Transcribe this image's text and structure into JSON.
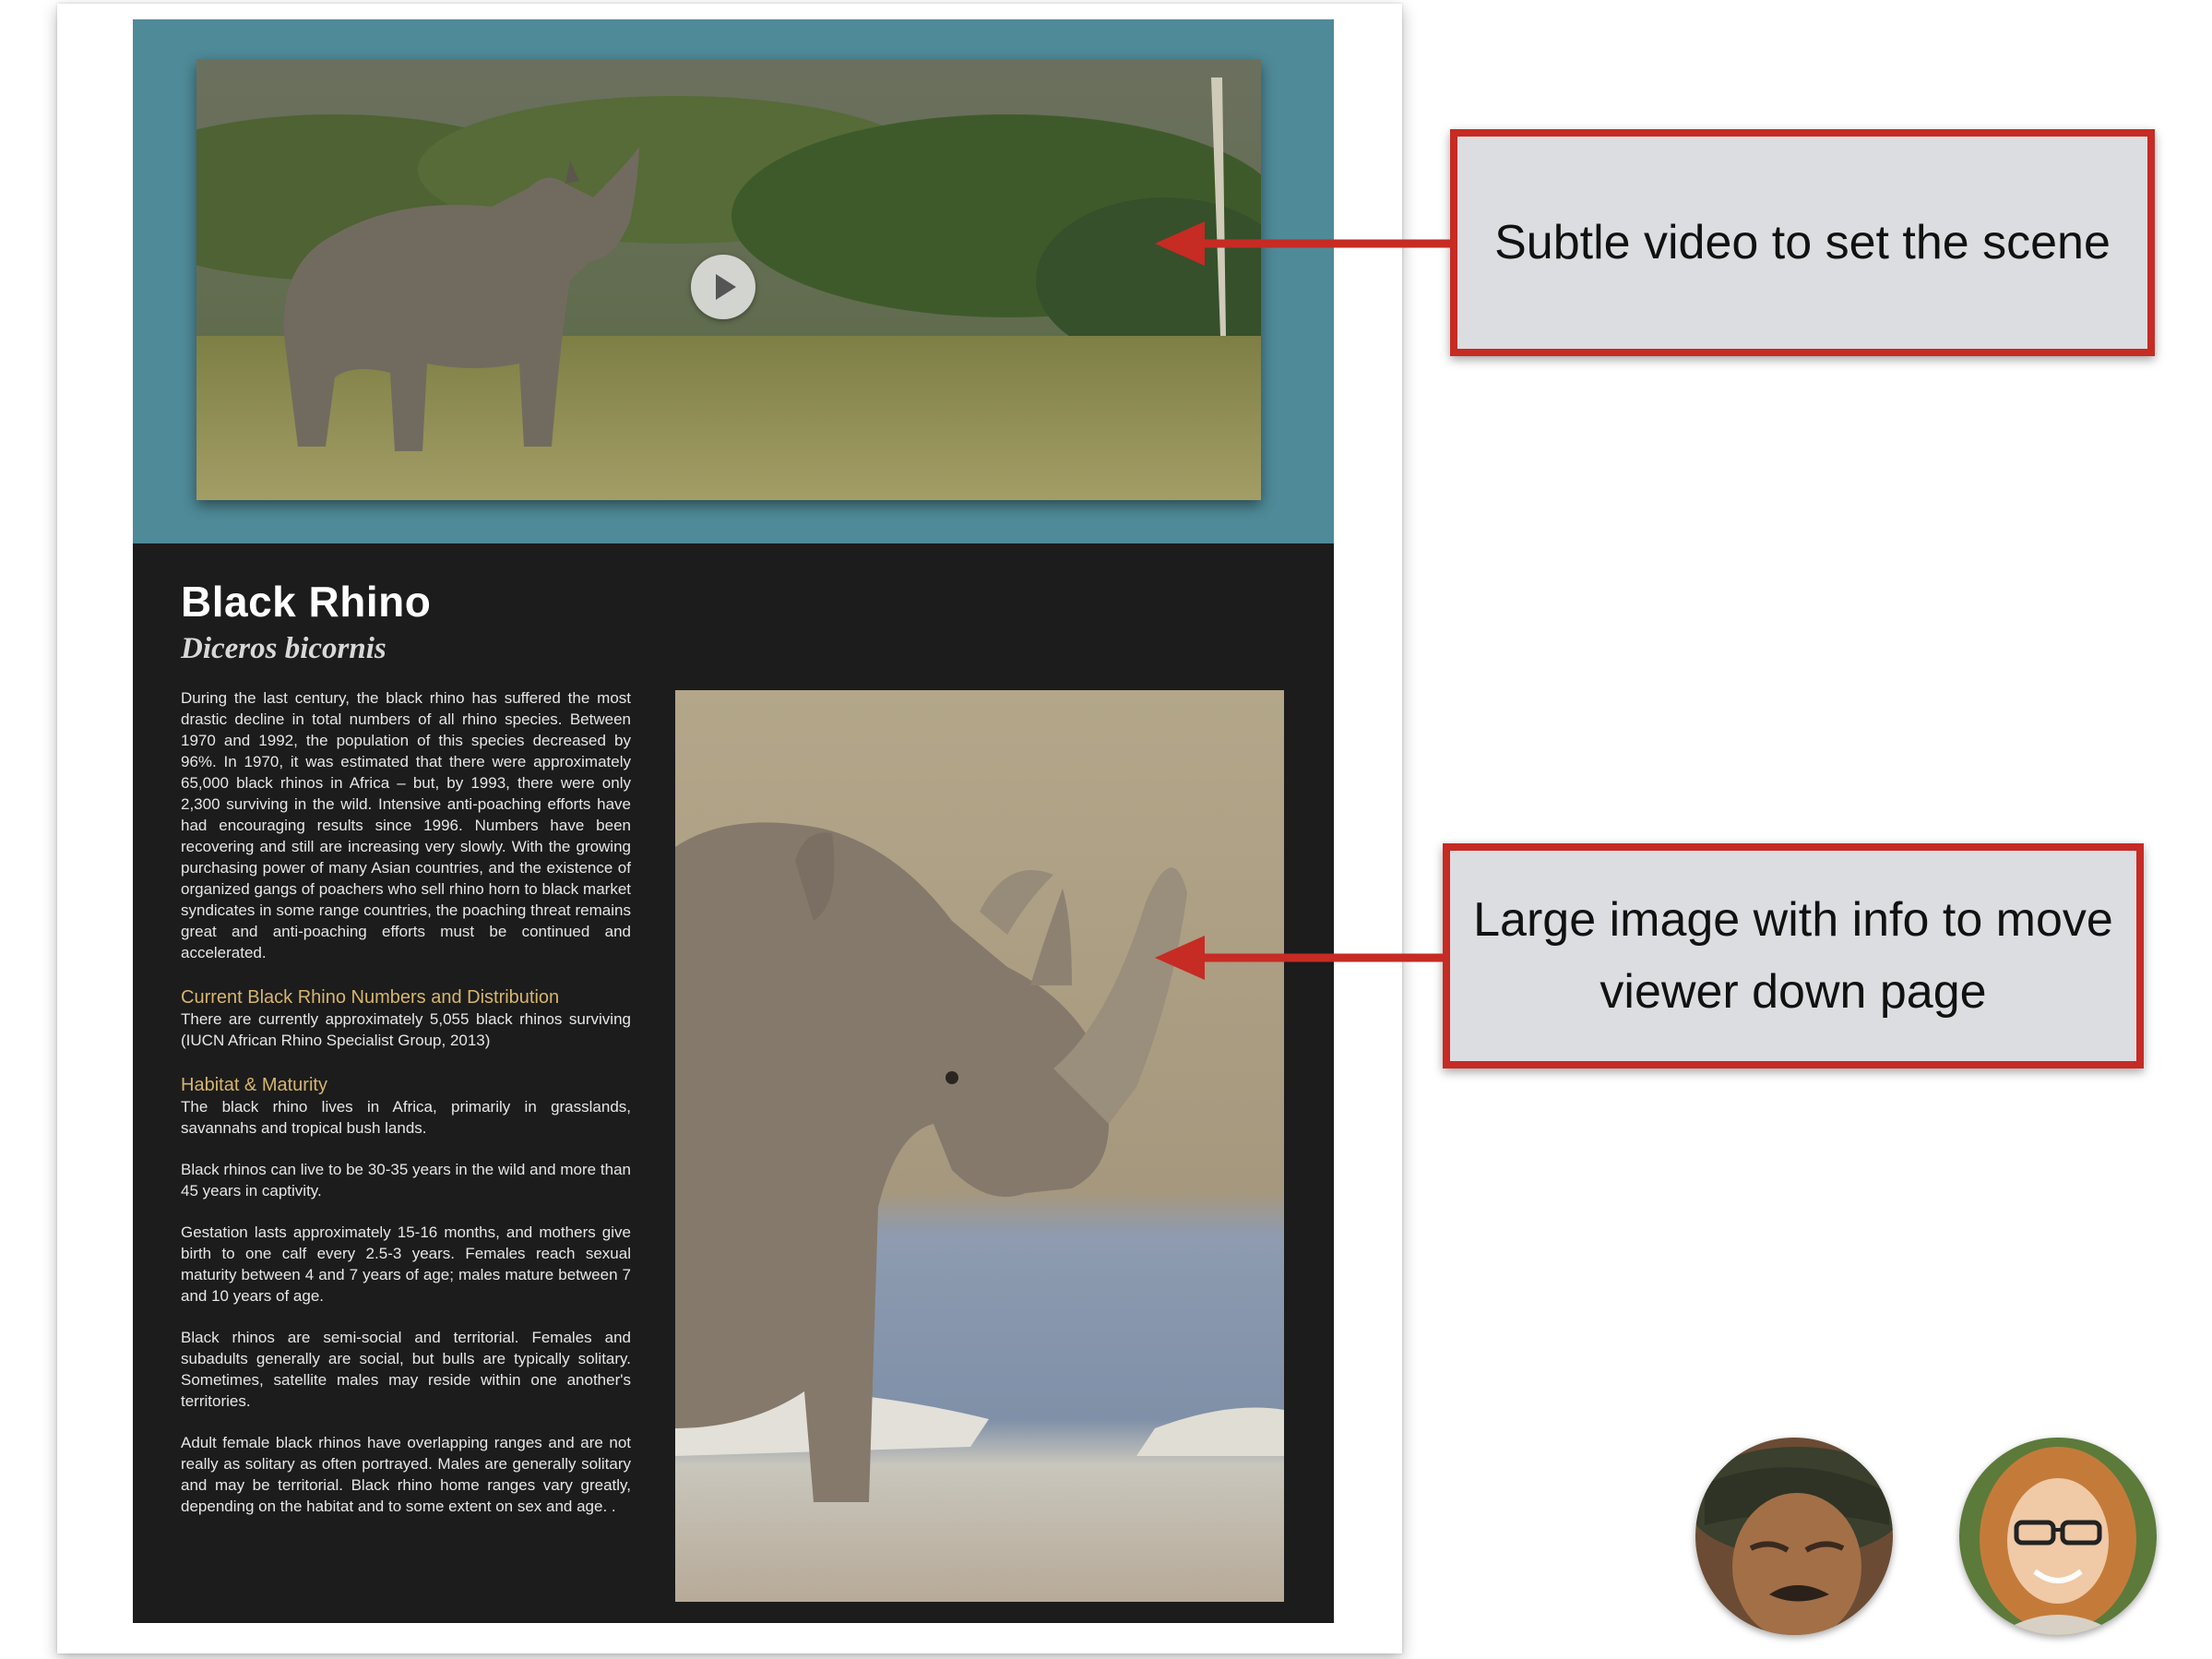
{
  "page": {
    "title": "Black Rhino",
    "scientific_name": "Diceros bicornis"
  },
  "article": {
    "intro": "During the last century, the black rhino has suffered the most drastic decline in total numbers of all rhino species. Between 1970 and 1992, the population of this species decreased by 96%. In 1970, it was estimated that there were approximately 65,000 black rhinos in Africa – but, by 1993, there were only 2,300 surviving in the wild. Intensive anti-poaching efforts have had encouraging results since 1996. Numbers have been recovering and still are increasing very slowly. With the growing purchasing power of many Asian countries, and the existence of organized gangs of poachers who sell rhino horn to black market syndicates in some range countries, the poaching threat remains great and anti-poaching efforts must be continued and accelerated.",
    "numbers_heading": "Current Black Rhino Numbers and Distribution",
    "numbers_text": "There are currently approximately 5,055 black rhinos surviving (IUCN African Rhino Specialist Group, 2013)",
    "habitat_heading": "Habitat & Maturity",
    "habitat_p1": "The black rhino lives in Africa, primarily in grasslands, savannahs and tropical bush lands.",
    "habitat_p2": "Black rhinos can live to be 30-35 years in the wild and more than 45 years in captivity.",
    "habitat_p3": "Gestation lasts approximately 15-16 months, and mothers give birth to one calf every 2.5-3 years. Females reach sexual maturity between 4 and 7 years of age; males mature between 7 and 10 years of age.",
    "habitat_p4": "Black rhinos are semi-social and territorial. Females and subadults generally are social, but bulls are typically solitary. Sometimes, satellite males may reside within one another's territories.",
    "habitat_p5": "Adult female black rhinos have overlapping ranges and are not really as solitary as often portrayed. Males are generally solitary and may be territorial. Black rhino home ranges vary greatly, depending on the habitat and to some extent on sex and age. ."
  },
  "callouts": {
    "video": "Subtle video to set the scene",
    "image": "Large image with info to move viewer down page"
  },
  "icons": {
    "play": "play-icon"
  },
  "colors": {
    "header_band": "#4f8a98",
    "content_bg": "#1c1c1c",
    "heading_accent": "#d6b56e",
    "callout_border": "#c62b24",
    "callout_bg": "#dcdde1"
  }
}
